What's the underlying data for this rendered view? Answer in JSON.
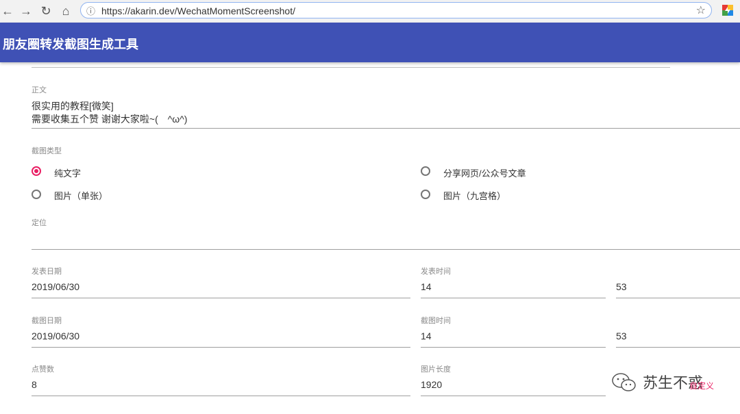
{
  "browser": {
    "back": "←",
    "forward": "→",
    "reload": "↻",
    "home": "⌂",
    "info_icon": "ⓘ",
    "url": "https://akarin.dev/WechatMomentScreenshot/",
    "star": "☆"
  },
  "app": {
    "title": "朋友圈转发截图生成工具"
  },
  "content": {
    "label": "正文",
    "line1": "很实用的教程[微笑]",
    "line2": "需要收集五个赞 谢谢大家啦~(　^ω^)"
  },
  "type": {
    "label": "截图类型",
    "options": [
      {
        "label": "纯文字",
        "selected": true
      },
      {
        "label": "分享网页/公众号文章",
        "selected": false
      },
      {
        "label": "图片（单张）",
        "selected": false
      },
      {
        "label": "图片（九宫格）",
        "selected": false
      }
    ]
  },
  "location": {
    "label": "定位",
    "value": ""
  },
  "post": {
    "date_label": "发表日期",
    "date": "2019/06/30",
    "time_label": "发表时间",
    "hour": "14",
    "minute": "53"
  },
  "shot": {
    "date_label": "截图日期",
    "date": "2019/06/30",
    "time_label": "截图时间",
    "hour": "14",
    "minute": "53"
  },
  "likes": {
    "label": "点赞数",
    "value": "8"
  },
  "image_length": {
    "label": "图片长度",
    "value": "1920"
  },
  "custom_link": "自定义",
  "watermark": "苏生不惑",
  "colors": {
    "app_bar": "#3f51b5",
    "accent": "#e91e63"
  }
}
